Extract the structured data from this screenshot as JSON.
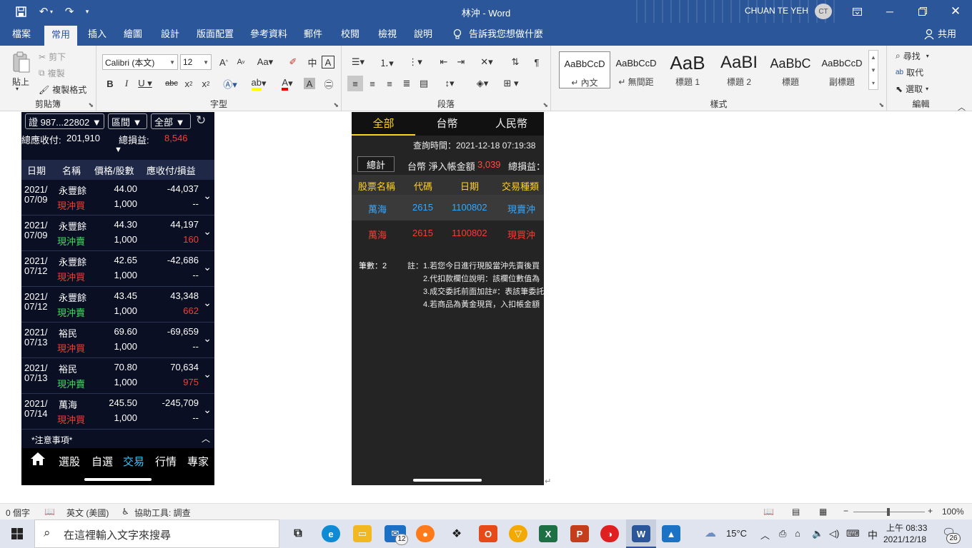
{
  "window": {
    "title": "林沖 - Word",
    "user": "CHUAN TE YEH",
    "avatar_initials": "CT"
  },
  "ribbon_tabs": [
    "檔案",
    "常用",
    "插入",
    "繪圖",
    "設計",
    "版面配置",
    "參考資料",
    "郵件",
    "校閱",
    "檢視",
    "說明",
    "告訴我您想做什麼"
  ],
  "share_label": "共用",
  "clipboard": {
    "paste": "貼上",
    "cut": "剪下",
    "copy": "複製",
    "format_painter": "複製格式",
    "label": "剪貼簿"
  },
  "font": {
    "name": "Calibri (本文)",
    "size": "12",
    "label": "字型"
  },
  "paragraph": {
    "label": "段落"
  },
  "styles": {
    "label": "樣式",
    "items": [
      {
        "sample": "AaBbCcD",
        "name": "↵ 內文"
      },
      {
        "sample": "AaBbCcD",
        "name": "↵ 無間距"
      },
      {
        "sample": "AaB",
        "name": "標題 1"
      },
      {
        "sample": "AaBI",
        "name": "標題 2"
      },
      {
        "sample": "AaBbC",
        "name": "標題"
      },
      {
        "sample": "AaBbCcD",
        "name": "副標題"
      }
    ]
  },
  "editing": {
    "find": "尋找",
    "replace": "取代",
    "select": "選取",
    "label": "編輯"
  },
  "left_app": {
    "filters": [
      "證 987...22802 ▼",
      "區間 ▼",
      "全部 ▼"
    ],
    "summary_receivable_label": "總應收付:",
    "summary_receivable": "201,910",
    "summary_pnl_label": "總損益:",
    "summary_pnl": "8,546",
    "headers": [
      "日期",
      "名稱",
      "價格/股數",
      "應收付/損益"
    ],
    "rows": [
      {
        "date1": "2021/",
        "date2": "07/09",
        "name": "永豐餘",
        "action": "現沖買",
        "action_color": "#ff3b30",
        "price": "44.00",
        "qty": "1,000",
        "amount": "-44,037",
        "pnl": "--",
        "pnl_color": "#ffffff"
      },
      {
        "date1": "2021/",
        "date2": "07/09",
        "name": "永豐餘",
        "action": "現沖賣",
        "action_color": "#3fe05a",
        "price": "44.30",
        "qty": "1,000",
        "amount": "44,197",
        "pnl": "160",
        "pnl_color": "#ff3b30"
      },
      {
        "date1": "2021/",
        "date2": "07/12",
        "name": "永豐餘",
        "action": "現沖買",
        "action_color": "#ff3b30",
        "price": "42.65",
        "qty": "1,000",
        "amount": "-42,686",
        "pnl": "--",
        "pnl_color": "#ffffff"
      },
      {
        "date1": "2021/",
        "date2": "07/12",
        "name": "永豐餘",
        "action": "現沖賣",
        "action_color": "#3fe05a",
        "price": "43.45",
        "qty": "1,000",
        "amount": "43,348",
        "pnl": "662",
        "pnl_color": "#ff3b30"
      },
      {
        "date1": "2021/",
        "date2": "07/13",
        "name": "裕民",
        "action": "現沖買",
        "action_color": "#ff3b30",
        "price": "69.60",
        "qty": "1,000",
        "amount": "-69,659",
        "pnl": "--",
        "pnl_color": "#ffffff"
      },
      {
        "date1": "2021/",
        "date2": "07/13",
        "name": "裕民",
        "action": "現沖賣",
        "action_color": "#3fe05a",
        "price": "70.80",
        "qty": "1,000",
        "amount": "70,634",
        "pnl": "975",
        "pnl_color": "#ff3b30"
      },
      {
        "date1": "2021/",
        "date2": "07/14",
        "name": "萬海",
        "action": "現沖買",
        "action_color": "#ff3b30",
        "price": "245.50",
        "qty": "1,000",
        "amount": "-245,709",
        "pnl": "--",
        "pnl_color": "#ffffff"
      }
    ],
    "notice": "*注意事項*",
    "nav": [
      "選股",
      "自選",
      "交易",
      "行情",
      "專家"
    ]
  },
  "right_app": {
    "tabs": [
      "全部",
      "台幣",
      "人民幣"
    ],
    "query_time": "查詢時間：2021-12-18 07:19:38",
    "total_btn": "總計",
    "net_label": "台幣 淨入帳金額",
    "net_value": "3,039",
    "pnl_label": "總損益：",
    "headers": [
      "股票名稱",
      "代碼",
      "日期",
      "交易種類"
    ],
    "rows": [
      {
        "name": "萬海",
        "code": "2615",
        "date": "1100802",
        "type": "現賣沖",
        "color": "#35a8ff"
      },
      {
        "name": "萬海",
        "code": "2615",
        "date": "1100802",
        "type": "現買沖",
        "color": "#ff3b30"
      }
    ],
    "count": "筆數：2",
    "notes": [
      "註：1.若您今日進行現股當沖先賣後買",
      "2.代扣款欄位說明：該欄位數值為",
      "3.成交委託前面加註#：表該筆委託",
      "4.若商品為黃金現貨，入扣帳金額"
    ]
  },
  "status": {
    "words": "0 個字",
    "language": "英文 (美國)",
    "accessibility": "協助工具: 調查",
    "zoom": "100%"
  },
  "taskbar": {
    "search_placeholder": "在這裡輸入文字來搜尋",
    "mail_badge": "12",
    "weather": "15°C",
    "ime": "中",
    "time": "上午 08:33",
    "date": "2021/12/18",
    "notifications": "26"
  }
}
